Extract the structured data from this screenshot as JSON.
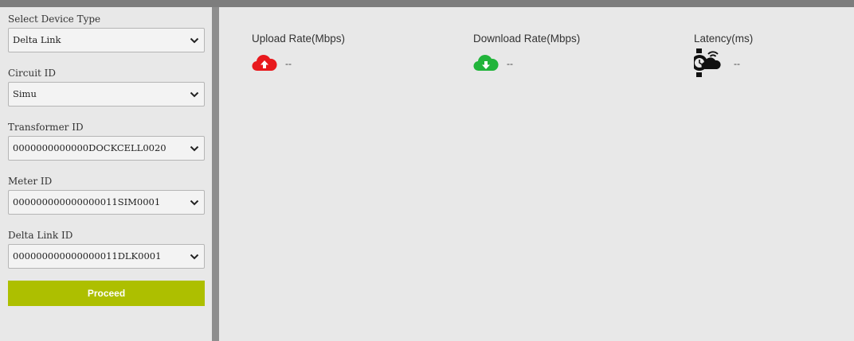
{
  "sidebar": {
    "device_type": {
      "label": "Select Device Type",
      "value": "Delta Link"
    },
    "circuit": {
      "label": "Circuit ID",
      "value": "Simu"
    },
    "transformer": {
      "label": "Transformer ID",
      "value": "0000000000000DOCKCELL0020"
    },
    "meter": {
      "label": "Meter ID",
      "value": "000000000000000011SIM0001"
    },
    "delta_link": {
      "label": "Delta Link ID",
      "value": "000000000000000011DLK0001"
    },
    "proceed_label": "Proceed"
  },
  "metrics": {
    "upload": {
      "title": "Upload Rate(Mbps)",
      "value": "--",
      "icon": "cloud-upload-icon",
      "color": "#e8191d"
    },
    "download": {
      "title": "Download Rate(Mbps)",
      "value": "--",
      "icon": "cloud-download-icon",
      "color": "#21b43a"
    },
    "latency": {
      "title": "Latency(ms)",
      "value": "--",
      "icon": "watch-cloud-icon",
      "color": "#111111"
    }
  },
  "colors": {
    "proceed_button": "#adbf00",
    "panel_background": "#e8e8e8",
    "frame": "#8c8c8c"
  }
}
